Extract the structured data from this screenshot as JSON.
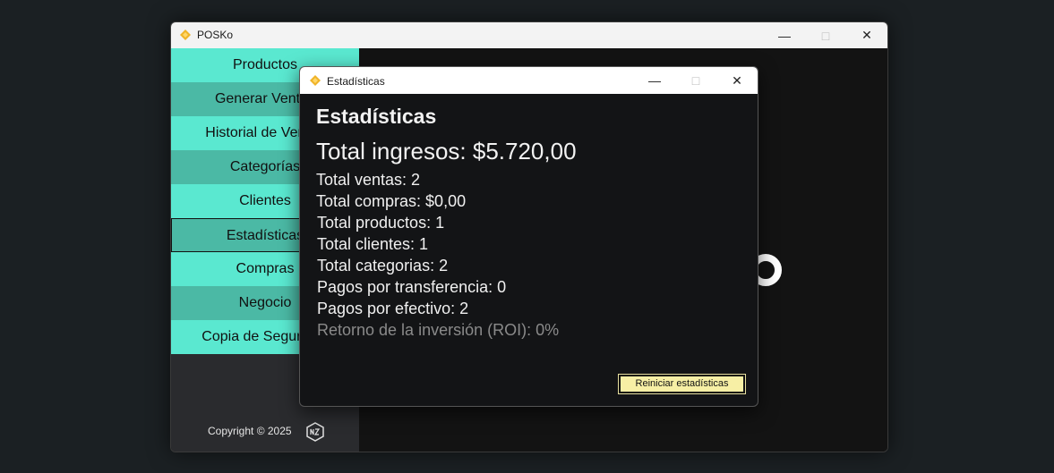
{
  "main_window": {
    "title": "POSKo",
    "sidebar": {
      "items": [
        {
          "label": "Productos"
        },
        {
          "label": "Generar Ventas"
        },
        {
          "label": "Historial de Ventas"
        },
        {
          "label": "Categorías"
        },
        {
          "label": "Clientes"
        },
        {
          "label": "Estadísticas"
        },
        {
          "label": "Compras"
        },
        {
          "label": "Negocio"
        },
        {
          "label": "Copia de Seguridad"
        }
      ],
      "copyright": "Copyright ©  2025"
    }
  },
  "dialog": {
    "title": "Estadísticas",
    "heading": "Estadísticas",
    "total_income": "Total ingresos: $5.720,00",
    "stats": [
      "Total ventas: 2",
      "Total compras: $0,00",
      "Total productos: 1",
      "Total clientes: 1",
      "Total categorias: 2",
      "Pagos por transferencia: 0",
      "Pagos por efectivo: 2",
      "Retorno de la inversión (ROI): 0%"
    ],
    "reset_button": "Reiniciar estadísticas"
  },
  "colors": {
    "accent_light": "#5ae8d0",
    "accent_dark": "#4bb9a5",
    "button_yellow": "#f7efa5",
    "app_icon": "#f0b429"
  },
  "icons": [
    "app-logo-icon",
    "minimize-icon",
    "maximize-icon",
    "close-icon",
    "nss-logo-icon"
  ]
}
